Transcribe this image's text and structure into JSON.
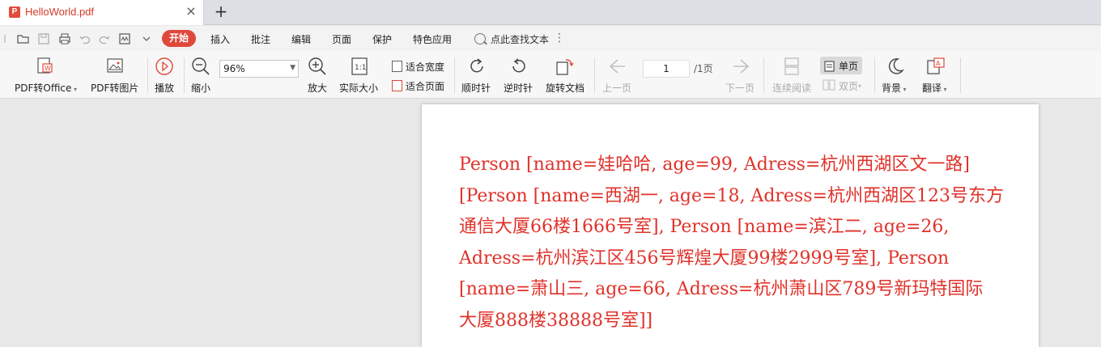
{
  "tab": {
    "title": "HelloWorld.pdf",
    "badge": "P",
    "close": "×",
    "new_tab": "+"
  },
  "menu": {
    "active": "开始",
    "items": [
      "插入",
      "批注",
      "编辑",
      "页面",
      "保护",
      "特色应用"
    ],
    "search": "点此查找文本",
    "more": "⋮"
  },
  "toolbar": {
    "pdf_to_office": "PDF转Office",
    "pdf_to_image": "PDF转图片",
    "play": "播放",
    "zoom_out": "缩小",
    "zoom_value": "96%",
    "zoom_in": "放大",
    "actual_size": "实际大小",
    "fit_width": "适合宽度",
    "fit_page": "适合页面",
    "rotate_cw": "顺时针",
    "rotate_ccw": "逆时针",
    "rotate_doc": "旋转文档",
    "prev_page": "上一页",
    "page_current": "1",
    "page_total": "/1页",
    "next_page": "下一页",
    "continuous": "连续阅读",
    "single_page": "单页",
    "double_page": "双页",
    "background": "背景",
    "translate": "翻译"
  },
  "document": {
    "lines": [
      "Person [name=娃哈哈, age=99, Adress=杭州西湖区文一路]",
      "[Person [name=西湖一, age=18, Adress=杭州西湖区123号东方",
      "通信大厦66楼1666号室], Person [name=滨江二, age=26,",
      "Adress=杭州滨江区456号辉煌大厦99楼2999号室], Person",
      "[name=萧山三, age=66, Adress=杭州萧山区789号新玛特国际",
      "大厦888楼38888号室]]"
    ],
    "text_color": "#e0322a"
  },
  "colors": {
    "accent": "#e0483a",
    "tab_title": "#d33a2a"
  }
}
